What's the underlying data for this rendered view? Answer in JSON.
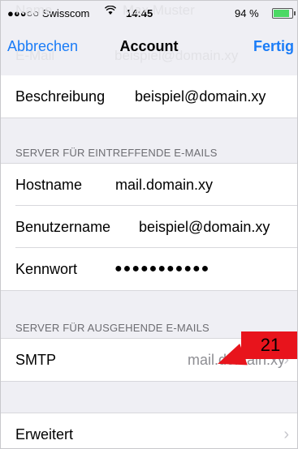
{
  "status": {
    "carrier": "●●●○○ Swisscom",
    "wifi_icon": "wifi-icon",
    "time": "14:45",
    "battery_pct": "94 %",
    "battery_level": 0.94
  },
  "ghost": {
    "title": "Max Muster",
    "left": "Name",
    "email_label": "E-Mail",
    "email_value": "beispiel@domain.xy"
  },
  "navbar": {
    "cancel": "Abbrechen",
    "title": "Account",
    "done": "Fertig"
  },
  "account": {
    "description_label": "Beschreibung",
    "description_value": "beispiel@domain.xy"
  },
  "incoming": {
    "header": "SERVER FÜR EINTREFFENDE E-MAILS",
    "hostname_label": "Hostname",
    "hostname_value": "mail.domain.xy",
    "username_label": "Benutzername",
    "username_value": "beispiel@domain.xy",
    "password_label": "Kennwort",
    "password_value": "●●●●●●●●●●●"
  },
  "outgoing": {
    "header": "SERVER FÜR AUSGEHENDE E-MAILS",
    "smtp_label": "SMTP",
    "smtp_value": "mail.domain.xy"
  },
  "advanced": {
    "label": "Erweitert"
  },
  "callout": {
    "number": "21",
    "color": "#e8141c"
  },
  "colors": {
    "accent": "#1a7cf7",
    "background": "#efeff4"
  }
}
